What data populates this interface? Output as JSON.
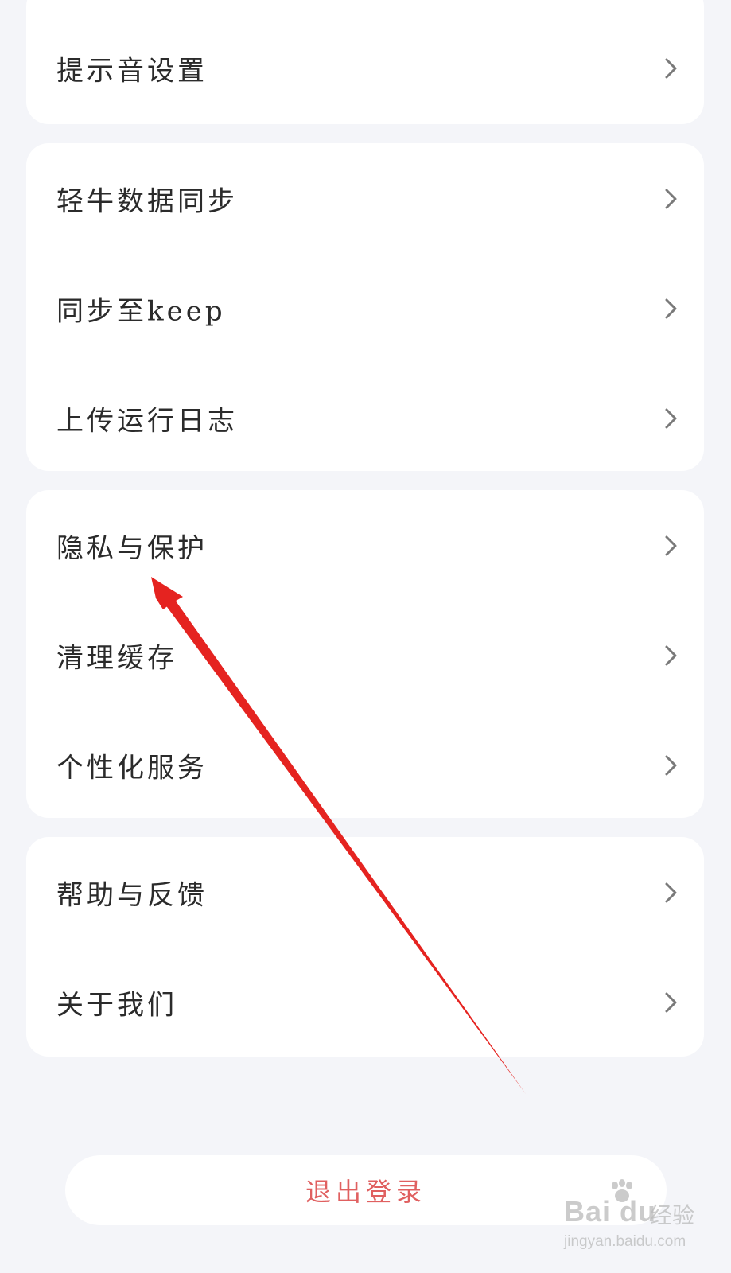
{
  "settings": {
    "group1": {
      "items": [
        {
          "label": "提示音设置"
        }
      ]
    },
    "group2": {
      "items": [
        {
          "label": "轻牛数据同步"
        },
        {
          "label": "同步至keep"
        },
        {
          "label": "上传运行日志"
        }
      ]
    },
    "group3": {
      "items": [
        {
          "label": "隐私与保护"
        },
        {
          "label": "清理缓存"
        },
        {
          "label": "个性化服务"
        }
      ]
    },
    "group4": {
      "items": [
        {
          "label": "帮助与反馈"
        },
        {
          "label": "关于我们"
        }
      ]
    }
  },
  "logout": {
    "label": "退出登录"
  },
  "annotation": {
    "color": "#e52320"
  },
  "watermark": {
    "brand": "Bai du",
    "brand_cn": "经验",
    "url": "jingyan.baidu.com"
  },
  "icons": {
    "row_chevron": "chevron-right-icon",
    "watermark_logo": "paw-icon"
  }
}
